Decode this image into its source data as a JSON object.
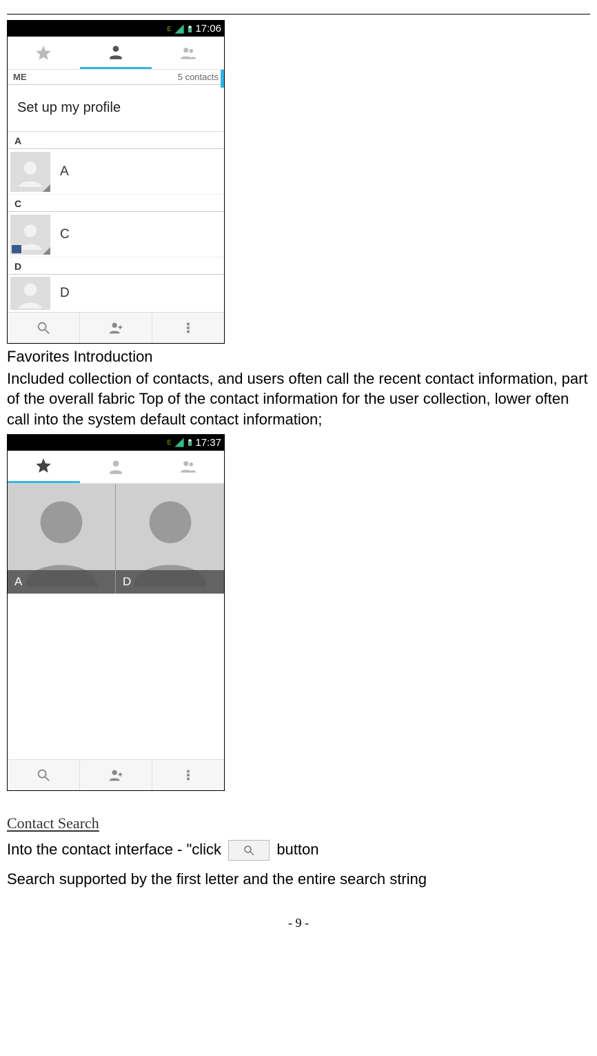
{
  "screenshot1": {
    "status_time": "17:06",
    "tabs": {
      "active": "person"
    },
    "me_label": "ME",
    "contacts_count": "5 contacts",
    "setup_profile": "Set up my profile",
    "groups": [
      {
        "letter": "A",
        "items": [
          {
            "name": "A",
            "sim": false
          }
        ]
      },
      {
        "letter": "C",
        "items": [
          {
            "name": "C",
            "sim": true
          }
        ]
      },
      {
        "letter": "D",
        "items": [
          {
            "name": "D",
            "sim": false
          }
        ]
      }
    ]
  },
  "text1_heading": "Favorites Introduction",
  "text1_body": "Included collection of contacts, and users often call the recent contact information, part of the overall fabric Top of the contact information for the user collection, lower often call into the system default contact information;",
  "screenshot2": {
    "status_time": "17:37",
    "tabs": {
      "active": "star"
    },
    "favorites": [
      {
        "label": "A"
      },
      {
        "label": "D"
      }
    ]
  },
  "contact_search_heading": "Contact Search",
  "text2_line1_a": "Into the contact interface - \"click",
  "text2_line1_b": "button",
  "text2_line2": "Search supported by the first letter and the entire search string",
  "page_number": "- 9 -"
}
